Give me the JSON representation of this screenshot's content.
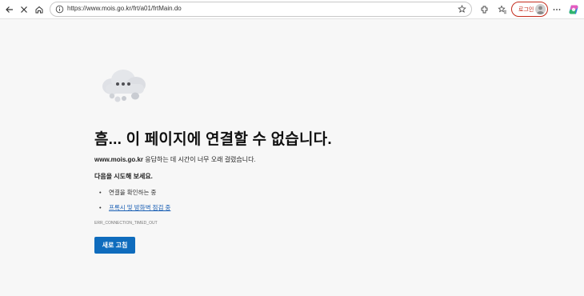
{
  "browser": {
    "url": "https://www.mois.go.kr/frt/a01/frtMain.do",
    "login_label": "로그인",
    "icons": [
      "back-arrow-icon",
      "close-icon",
      "home-icon",
      "info-icon",
      "star-icon",
      "extensions-icon",
      "favorites-icon",
      "more-icon",
      "copilot-icon"
    ]
  },
  "error_page": {
    "heading": "흠... 이 페이지에 연결할 수 없습니다.",
    "host": "www.mois.go.kr",
    "desc_rest": " 응답하는 데 시간이 너무 오래 걸렸습니다.",
    "try_label": "다음을 시도해 보세요.",
    "suggestions": [
      "연결을 확인하는 중",
      "프록시 및 방화벽 점검 중"
    ],
    "error_code": "ERR_CONNECTION_TIMED_OUT",
    "refresh_label": "새로 고침"
  },
  "colors": {
    "accent": "#0f6cbd",
    "login_red": "#c42b1c",
    "page_bg": "#f7f7f7"
  }
}
